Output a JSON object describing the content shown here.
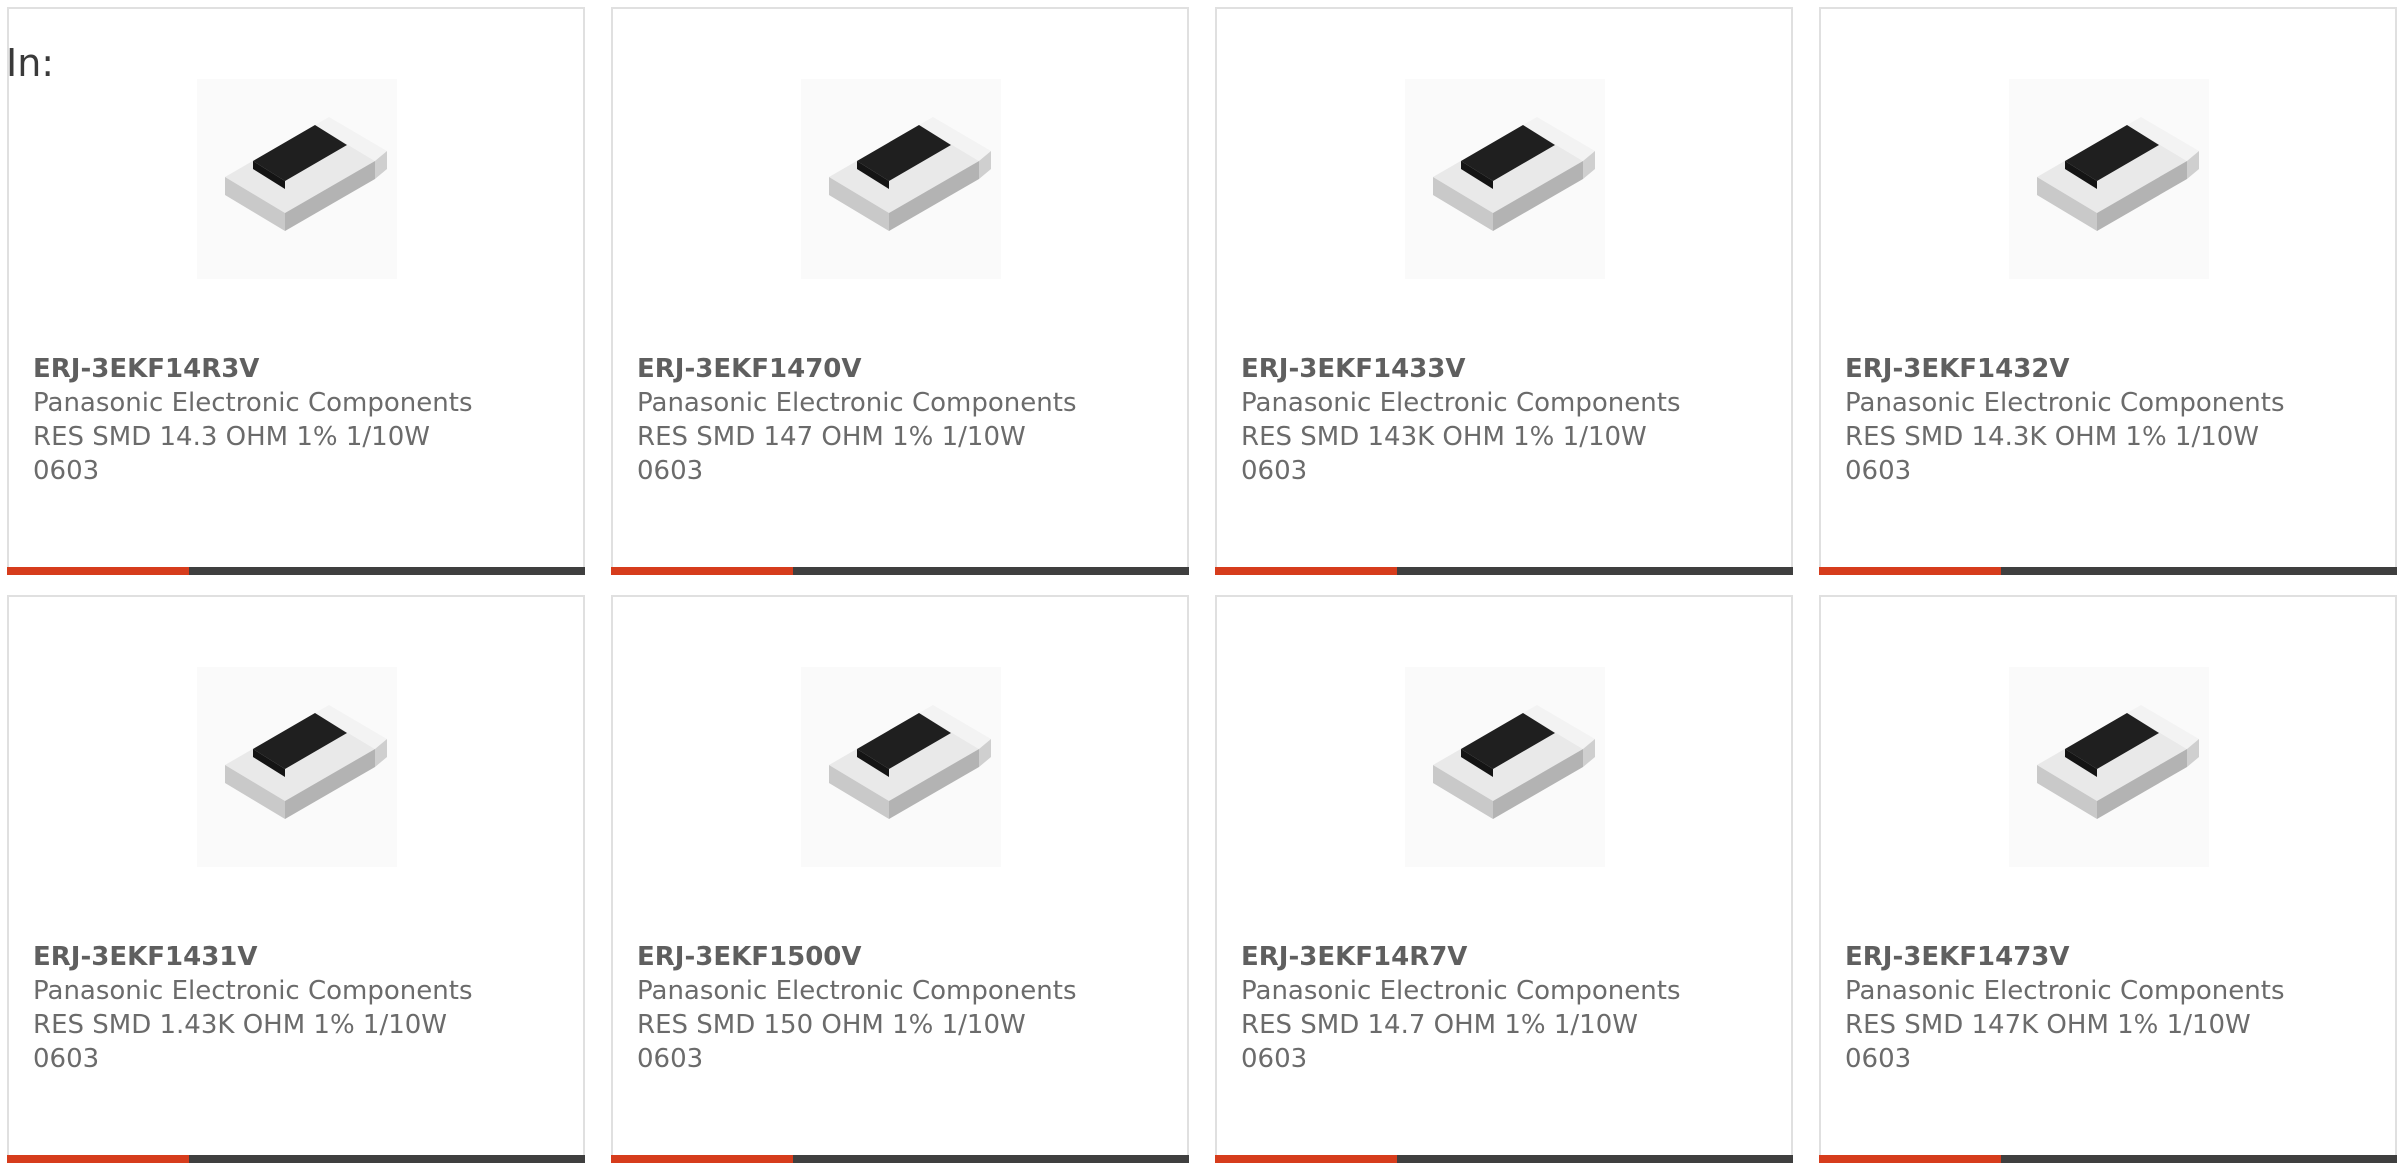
{
  "header": {
    "label": "In:"
  },
  "colors": {
    "accent": "#d63c1c",
    "bar_dark": "#3f3f3f",
    "card_border": "#e0e0e0",
    "text": "#6b6b6b"
  },
  "products": [
    {
      "part_number": "ERJ-3EKF14R3V",
      "manufacturer": "Panasonic Electronic Components",
      "description": "RES SMD 14.3 OHM 1% 1/10W 0603",
      "image_icon": "smd-resistor-chip-icon"
    },
    {
      "part_number": "ERJ-3EKF1470V",
      "manufacturer": "Panasonic Electronic Components",
      "description": "RES SMD 147 OHM 1% 1/10W 0603",
      "image_icon": "smd-resistor-chip-icon"
    },
    {
      "part_number": "ERJ-3EKF1433V",
      "manufacturer": "Panasonic Electronic Components",
      "description": "RES SMD 143K OHM 1% 1/10W 0603",
      "image_icon": "smd-resistor-chip-icon"
    },
    {
      "part_number": "ERJ-3EKF1432V",
      "manufacturer": "Panasonic Electronic Components",
      "description": "RES SMD 14.3K OHM 1% 1/10W 0603",
      "image_icon": "smd-resistor-chip-icon"
    },
    {
      "part_number": "ERJ-3EKF1431V",
      "manufacturer": "Panasonic Electronic Components",
      "description": "RES SMD 1.43K OHM 1% 1/10W 0603",
      "image_icon": "smd-resistor-chip-icon"
    },
    {
      "part_number": "ERJ-3EKF1500V",
      "manufacturer": "Panasonic Electronic Components",
      "description": "RES SMD 150 OHM 1% 1/10W 0603",
      "image_icon": "smd-resistor-chip-icon"
    },
    {
      "part_number": "ERJ-3EKF14R7V",
      "manufacturer": "Panasonic Electronic Components",
      "description": "RES SMD 14.7 OHM 1% 1/10W 0603",
      "image_icon": "smd-resistor-chip-icon"
    },
    {
      "part_number": "ERJ-3EKF1473V",
      "manufacturer": "Panasonic Electronic Components",
      "description": "RES SMD 147K OHM 1% 1/10W 0603",
      "image_icon": "smd-resistor-chip-icon"
    }
  ]
}
